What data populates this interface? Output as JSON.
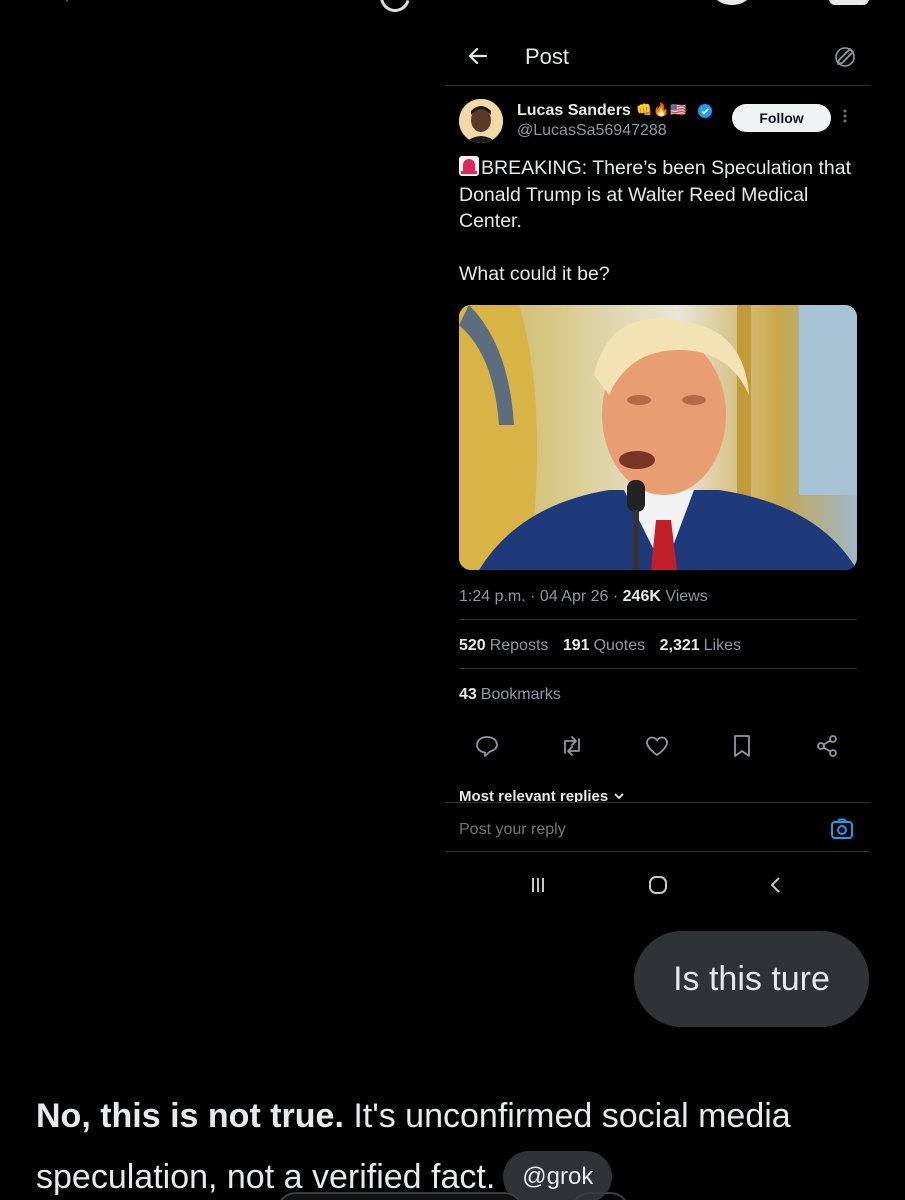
{
  "post_header": {
    "title": "Post"
  },
  "author": {
    "name": "Lucas Sanders",
    "badges": [
      "👊",
      "🔥",
      "🇺🇸"
    ],
    "handle": "@LucasSa56947288",
    "follow_label": "Follow"
  },
  "post": {
    "line1": "BREAKING: There’s been Speculation that Donald Trump is at Walter Reed Medical Center.",
    "line2": "What could it be?"
  },
  "meta": {
    "time": "1:24 p.m.",
    "date": "04 Apr 26",
    "views_count": "246K",
    "views_label": "Views"
  },
  "stats": {
    "reposts_count": "520",
    "reposts_label": "Reposts",
    "quotes_count": "191",
    "quotes_label": "Quotes",
    "likes_count": "2,321",
    "likes_label": "Likes",
    "bookmarks_count": "43",
    "bookmarks_label": "Bookmarks"
  },
  "replies": {
    "sort_label": "Most relevant replies",
    "placeholder": "Post your reply"
  },
  "chat": {
    "user_message": "Is this ture",
    "reply_bold": "No, this is not true.",
    "reply_rest": " It's unconfirmed social media speculation, not a verified fact.",
    "source_chip": "@grok"
  },
  "colors": {
    "background": "#000000",
    "text": "#e7e9ea",
    "secondary_text": "#8b98a5",
    "bubble": "#2f3336",
    "verified_blue": "#1d9bf0"
  },
  "icons": [
    "back-arrow-icon",
    "edit-icon",
    "verified-icon",
    "more-icon",
    "reply-icon",
    "repost-icon",
    "like-icon",
    "bookmark-icon",
    "share-icon",
    "chevron-down-icon",
    "camera-icon",
    "recents-icon",
    "home-icon",
    "nav-back-icon"
  ]
}
